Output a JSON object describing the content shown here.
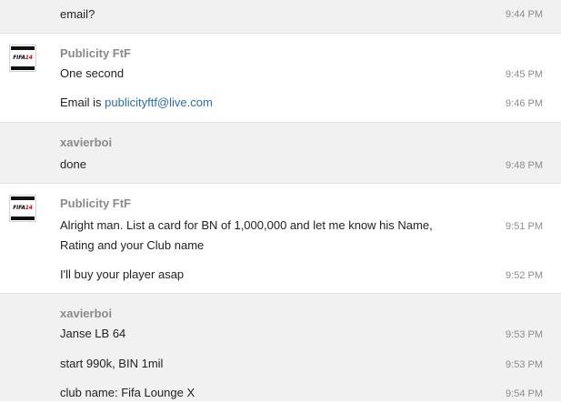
{
  "messages": {
    "m0": {
      "text": "email?",
      "time": "9:44 PM"
    },
    "g1": {
      "author": "Publicity FtF",
      "avatar": {
        "logo_main": "FIFA",
        "logo_num": "14"
      },
      "m1": {
        "text": "One second",
        "time": "9:45 PM"
      },
      "m2": {
        "prefix": "Email is ",
        "email": "publicityftf@live.com",
        "time": "9:46 PM"
      }
    },
    "g2": {
      "author": "xavierboi",
      "m1": {
        "text": "done",
        "time": "9:48 PM"
      }
    },
    "g3": {
      "author": "Publicity FtF",
      "avatar": {
        "logo_main": "FIFA",
        "logo_num": "14"
      },
      "m1": {
        "line1": "Alright man. List a card for BN of 1,000,000 and let me know his Name,",
        "line2": "Rating and your Club name",
        "time": "9:51 PM"
      },
      "m2": {
        "text": "I'll buy your player asap",
        "time": "9:52 PM"
      }
    },
    "g4": {
      "author": "xavierboi",
      "m1": {
        "text": "Janse LB 64",
        "time": "9:53 PM"
      },
      "m2": {
        "text": "start 990k, BIN 1mil",
        "time": "9:53 PM"
      },
      "m3": {
        "text": "club name: Fifa Lounge X",
        "time": "9:54 PM"
      }
    }
  },
  "colors": {
    "gray_bg": "#f1f1f1",
    "link": "#2a6db5",
    "author": "#8a8a8a",
    "time": "#8c8c8c"
  }
}
